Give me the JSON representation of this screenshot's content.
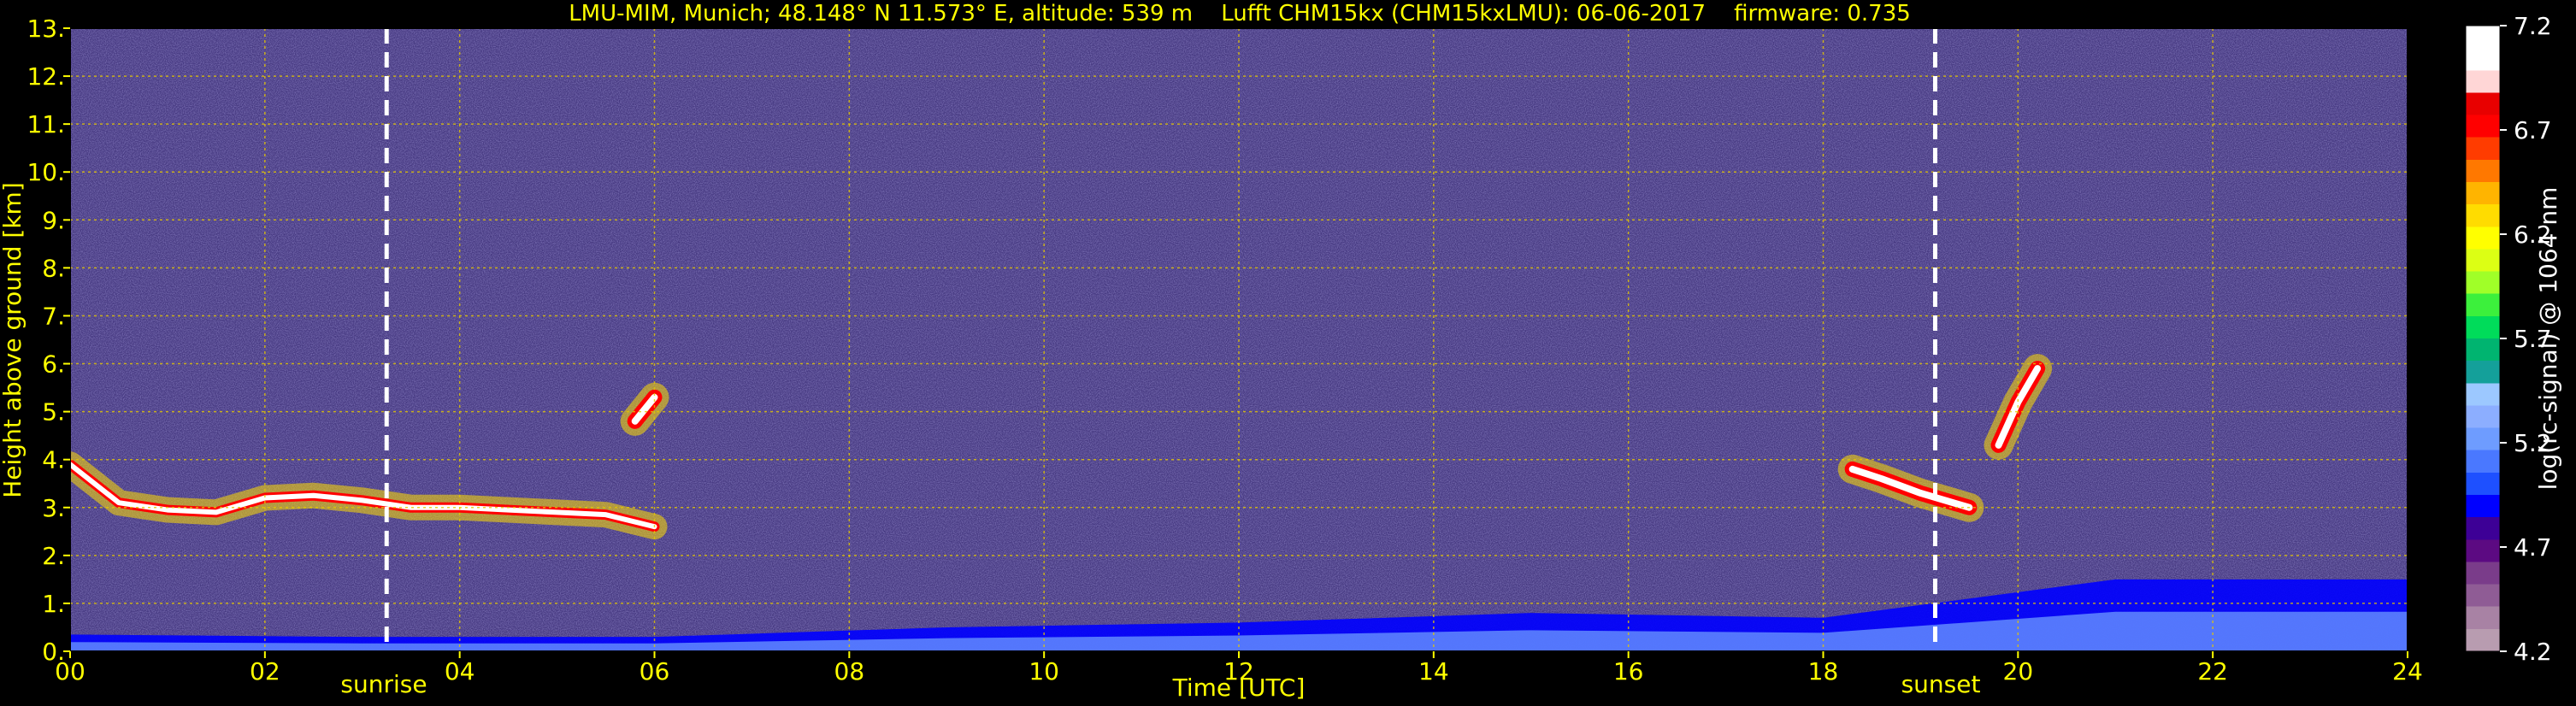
{
  "chart_data": {
    "type": "heatmap",
    "title": "LMU-MIM, Munich; 48.148° N 11.573° E, altitude: 539 m    Lufft CHM15kx (CHM15kxLMU): 06-06-2017    firmware: 0.735",
    "xlabel": "Time [UTC]",
    "ylabel": "Height above ground [km]",
    "xlim": [
      0,
      24
    ],
    "ylim": [
      0,
      13
    ],
    "x_ticks": [
      "00",
      "02",
      "04",
      "06",
      "08",
      "10",
      "12",
      "14",
      "16",
      "18",
      "20",
      "22",
      "24"
    ],
    "y_ticks": [
      "0.",
      "1.",
      "2.",
      "3.",
      "4.",
      "5.",
      "6.",
      "7.",
      "8.",
      "9.",
      "10.",
      "11.",
      "12.",
      "13."
    ],
    "grid": true,
    "sunrise": {
      "time": 3.25,
      "label": "sunrise"
    },
    "sunset": {
      "time": 19.15,
      "label": "sunset"
    },
    "colorbar": {
      "label": "log(rc-signal) @ 1064 nm",
      "range": [
        4.2,
        7.2
      ],
      "ticks": [
        "7.2",
        "6.7",
        "6.2",
        "5.7",
        "5.2",
        "4.7",
        "4.2"
      ],
      "colors": [
        "#b89cb0",
        "#a882a4",
        "#8f5c95",
        "#7a3c8a",
        "#5c0a82",
        "#3d0096",
        "#0000ff",
        "#1e50ff",
        "#4a78ff",
        "#6e9cff",
        "#8caeff",
        "#9cc8ff",
        "#14a09a",
        "#00b470",
        "#00dc5a",
        "#3cf03c",
        "#a0ff28",
        "#dcff14",
        "#ffff00",
        "#ffdc00",
        "#ffb400",
        "#ff7800",
        "#ff3c00",
        "#ff0000",
        "#e80000",
        "#ffd6d6",
        "#ffffff",
        "#ffffff"
      ]
    },
    "features": [
      {
        "name": "boundary layer top",
        "x": [
          0,
          0.5,
          1,
          1.5,
          2,
          2.5,
          3,
          3.5,
          4,
          4.5,
          5,
          5.5,
          6
        ],
        "y": [
          3.9,
          3.1,
          2.95,
          2.9,
          3.2,
          3.25,
          3.15,
          3.0,
          3.0,
          2.95,
          2.9,
          2.85,
          2.6
        ]
      },
      {
        "name": "aerosol layer near surface",
        "x": [
          0,
          3,
          6,
          9,
          12,
          15,
          18,
          21,
          24
        ],
        "y": [
          0.35,
          0.3,
          0.3,
          0.5,
          0.6,
          0.8,
          0.7,
          1.5,
          1.5
        ]
      },
      {
        "name": "cloud 18-19 UTC",
        "x": [
          18.3,
          18.6,
          19.0,
          19.5
        ],
        "y": [
          3.8,
          3.6,
          3.3,
          3.0
        ]
      },
      {
        "name": "high cloud 20 UTC",
        "x": [
          19.8,
          20.0,
          20.2
        ],
        "y": [
          4.3,
          5.2,
          5.9
        ]
      },
      {
        "name": "cloud 06 UTC",
        "x": [
          5.8,
          6.0
        ],
        "y": [
          4.8,
          5.3
        ]
      }
    ]
  }
}
